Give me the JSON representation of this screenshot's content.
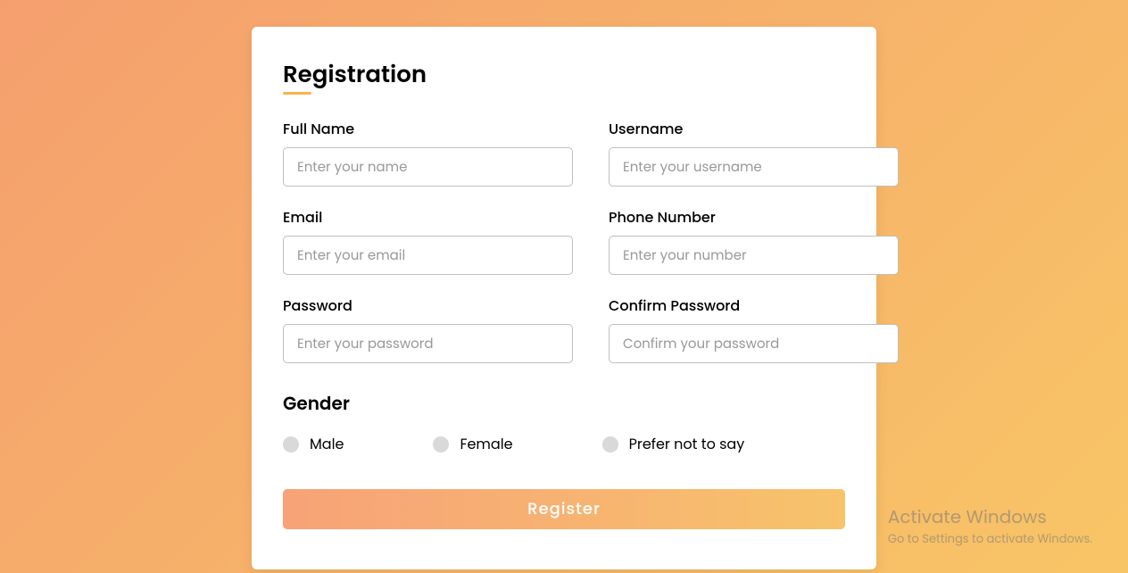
{
  "title": "Registration",
  "fields": {
    "fullname": {
      "label": "Full Name",
      "placeholder": "Enter your name"
    },
    "username": {
      "label": "Username",
      "placeholder": "Enter your username"
    },
    "email": {
      "label": "Email",
      "placeholder": "Enter your email"
    },
    "phone": {
      "label": "Phone Number",
      "placeholder": "Enter your number"
    },
    "password": {
      "label": "Password",
      "placeholder": "Enter your password"
    },
    "confirm": {
      "label": "Confirm Password",
      "placeholder": "Confirm your password"
    }
  },
  "gender": {
    "title": "Gender",
    "options": {
      "male": "Male",
      "female": "Female",
      "prefer": "Prefer not to say"
    }
  },
  "button": "Register",
  "watermark": {
    "title": "Activate Windows",
    "sub": "Go to Settings to activate Windows."
  }
}
